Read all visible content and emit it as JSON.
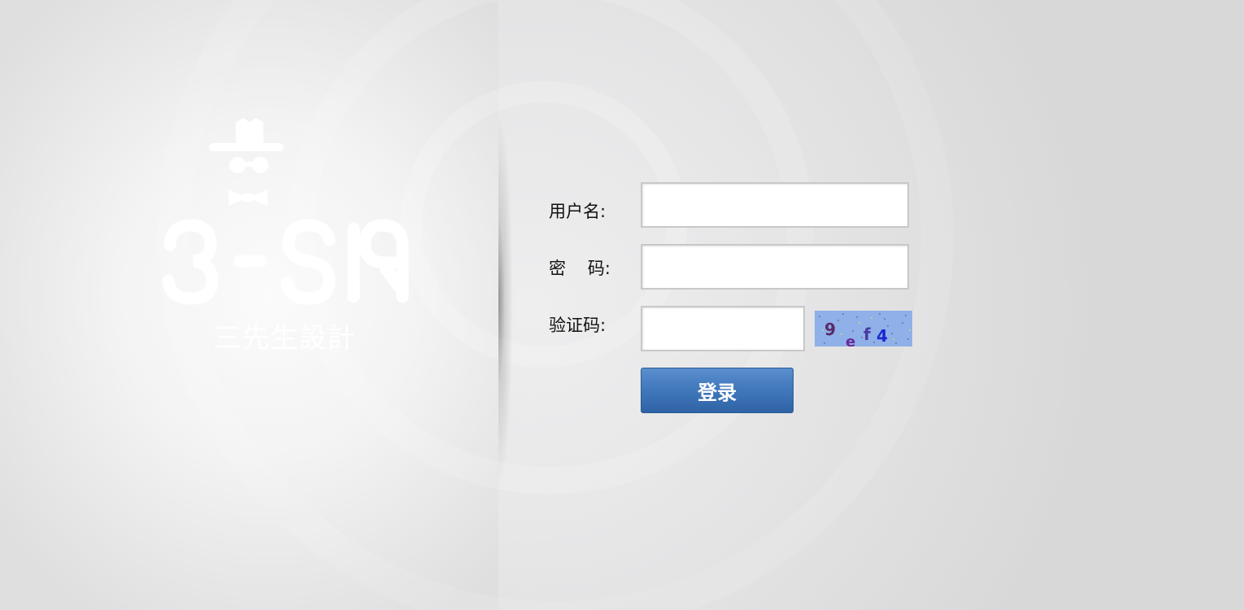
{
  "logo": {
    "mark_text": "3-SIR",
    "caption": "三先生設計"
  },
  "form": {
    "username_label": "用户名:",
    "username_value": "",
    "password_label": "密    码:",
    "password_value": "",
    "captcha_label": "验证码:",
    "captcha_value": "",
    "captcha_text": "9ef4",
    "login_label": "登录"
  },
  "colors": {
    "button": "#3a6fb4",
    "captcha_bg": "#8fb0e8"
  },
  "icons": [
    "hat-icon",
    "glasses-icon",
    "bowtie-icon",
    "captcha-image"
  ]
}
